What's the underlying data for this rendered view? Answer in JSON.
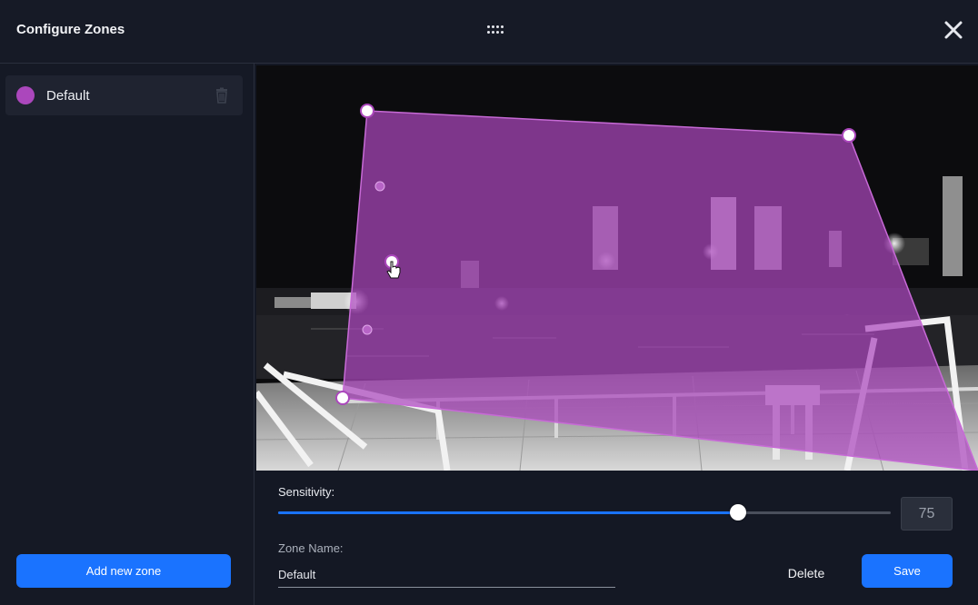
{
  "header": {
    "title": "Configure Zones",
    "drag_icon": "drag-dots-icon",
    "close_icon": "close-icon"
  },
  "sidebar": {
    "zones": [
      {
        "label": "Default",
        "color": "#ab47bc",
        "delete_icon": "trash-icon"
      }
    ],
    "add_zone_label": "Add new zone"
  },
  "editor": {
    "sensitivity_label": "Sensitivity:",
    "sensitivity_value": "75",
    "sensitivity_fraction": 0.75,
    "zone_name_label": "Zone Name:",
    "zone_name_value": "Default",
    "delete_label": "Delete",
    "save_label": "Save"
  },
  "colors": {
    "accent": "#1a73ff",
    "zone": "#ab47bc",
    "background": "#141824"
  }
}
